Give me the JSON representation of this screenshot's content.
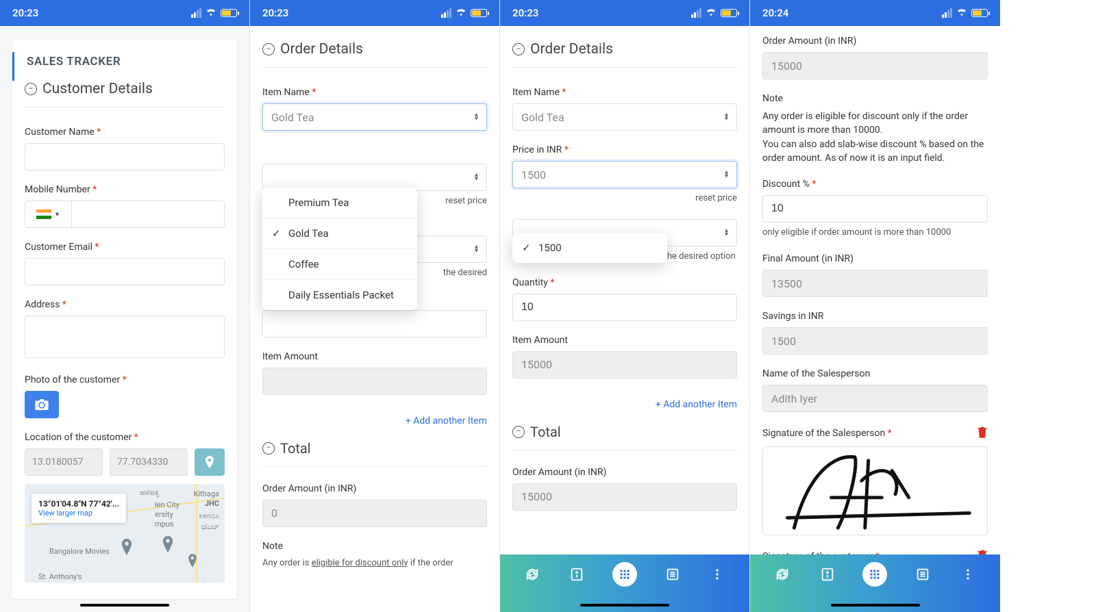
{
  "status": {
    "time1": "20:23",
    "time2": "20:23",
    "time3": "20:23",
    "time4": "20:24"
  },
  "app_title": "SALES TRACKER",
  "customer": {
    "section": "Customer Details",
    "name_label": "Customer Name",
    "mobile_label": "Mobile Number",
    "email_label": "Customer Email",
    "address_label": "Address",
    "photo_label": "Photo of the customer",
    "location_label": "Location of the customer",
    "lat": "13.0180057",
    "lng": "77.7034330",
    "map_coord": "13°01'04.8\"N 77°42'...",
    "map_link": "View larger map",
    "map_places": {
      "p1": "Kithaga",
      "p2": "JHC",
      "p3": "len City",
      "p4": "ersity",
      "p5": "mpus",
      "p6": "Bangalore Movies",
      "p7": "St. Anthony's",
      "p8": "ಹಳೆಹಳ್ಳಿ",
      "p9": "ಕಿತಗನೂ",
      "p10": "ಜೆಎಚ್"
    }
  },
  "order": {
    "section": "Order Details",
    "item_name_label": "Item Name",
    "item_name_value": "Gold Tea",
    "item_options": [
      "Premium Tea",
      "Gold Tea",
      "Coffee",
      "Daily Essentials Packet"
    ],
    "price_label": "Price in INR",
    "price_value": "1500",
    "price_options": [
      "1500"
    ],
    "reset_hint_partial": "reset price",
    "select_hint_partial": "the desired",
    "select_hint_full": "Select the Item Name and Price to get the desired option",
    "qty_label": "Quantity",
    "qty_value": "10",
    "item_amount_label": "Item Amount",
    "item_amount_value": "15000",
    "add_another": "+ Add another Item"
  },
  "total": {
    "section": "Total",
    "order_amount_label": "Order Amount (in INR)",
    "order_amount_zero": "0",
    "order_amount_value": "15000",
    "note_label": "Note",
    "note_text_partial": "Any order is eligible for discount only if the order",
    "note_text_full": "Any order is eligible for discount only if the order amount is more than 10000.\nYou can also add slab-wise discount % based on the order amount. As of now it is an input field.",
    "discount_label": "Discount %",
    "discount_value": "10",
    "discount_hint": "only eligible if order amount is more than 10000",
    "final_label": "Final Amount (in INR)",
    "final_value": "13500",
    "savings_label": "Savings in INR",
    "savings_value": "1500",
    "salesperson_label": "Name of the Salesperson",
    "salesperson_value": "Adith Iyer",
    "sig_sales_label": "Signature of the Salesperson",
    "sig_cust_label": "Signature of the customer"
  }
}
